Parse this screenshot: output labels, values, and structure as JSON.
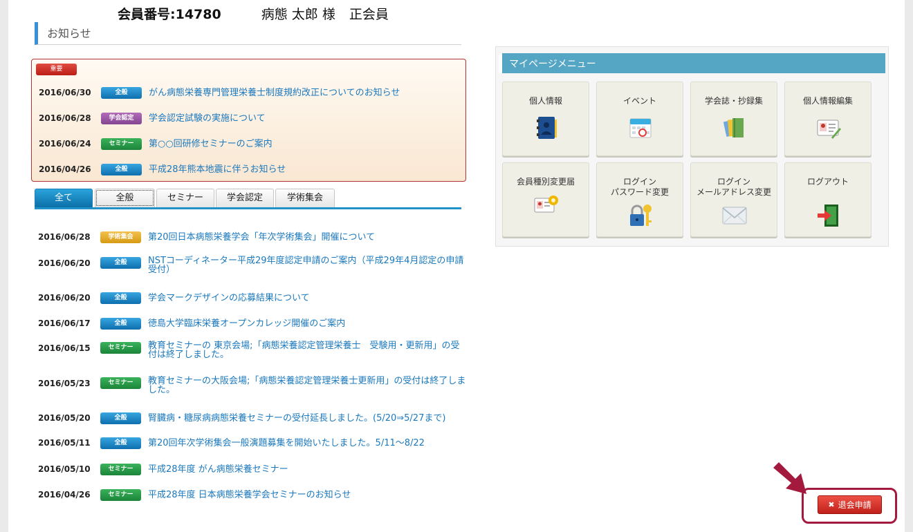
{
  "member": {
    "number": "会員番号:14780",
    "name": "病態 太郎 様",
    "type": "正会員"
  },
  "notices": {
    "heading": "お知らせ"
  },
  "important": {
    "label": "重要",
    "items": [
      {
        "date": "2016/06/30",
        "category": "全般",
        "title": "がん病態栄養専門管理栄養士制度規約改正についてのお知らせ"
      },
      {
        "date": "2016/06/28",
        "category": "学会認定",
        "title": "学会認定試験の実施について"
      },
      {
        "date": "2016/06/24",
        "category": "セミナー",
        "title": "第○○回研修セミナーのご案内"
      },
      {
        "date": "2016/04/26",
        "category": "全般",
        "title": "平成28年熊本地震に伴うお知らせ"
      }
    ]
  },
  "tabs": [
    "全て",
    "全般",
    "セミナー",
    "学会認定",
    "学術集会"
  ],
  "news": [
    {
      "date": "2016/06/28",
      "category": "学術集会",
      "title": "第20回日本病態栄養学会「年次学術集会」開催について"
    },
    {
      "date": "2016/06/20",
      "category": "全般",
      "title": "NSTコーディネーター平成29年度認定申請のご案内（平成29年4月認定の申請受付）"
    },
    {
      "date": "2016/06/20",
      "category": "全般",
      "title": "学会マークデザインの応募結果について"
    },
    {
      "date": "2016/06/17",
      "category": "全般",
      "title": "徳島大学臨床栄養オープンカレッジ開催のご案内"
    },
    {
      "date": "2016/06/15",
      "category": "セミナー",
      "title": "教育セミナーの 東京会場;「病態栄養認定管理栄養士　受験用・更新用」の受付は終了しました。"
    },
    {
      "date": "2016/05/23",
      "category": "セミナー",
      "title": "教育セミナーの大阪会場;「病態栄養認定管理栄養士更新用」の受付は終了しました。"
    },
    {
      "date": "2016/05/20",
      "category": "全般",
      "title": "腎臓病・糖尿病病態栄養セミナーの受付延長しました。(5/20⇒5/27まで)"
    },
    {
      "date": "2016/05/11",
      "category": "全般",
      "title": "第20回年次学術集会一般演題募集を開始いたしました。5/11～8/22"
    },
    {
      "date": "2016/05/10",
      "category": "セミナー",
      "title": "平成28年度 がん病態栄養セミナー"
    },
    {
      "date": "2016/04/26",
      "category": "セミナー",
      "title": "平成28年度 日本病態栄養学会セミナーのお知らせ"
    }
  ],
  "mypage": {
    "title": "マイページメニュー",
    "tiles": [
      {
        "label": "個人情報",
        "icon": "address-book-icon"
      },
      {
        "label": "イベント",
        "icon": "calendar-icon"
      },
      {
        "label": "学会誌・抄録集",
        "icon": "books-icon"
      },
      {
        "label": "個人情報編集",
        "icon": "id-card-edit-icon"
      },
      {
        "label": "会員種別変更届",
        "icon": "id-card-gear-icon"
      },
      {
        "label": "ログイン\nパスワード変更",
        "icon": "lock-key-icon"
      },
      {
        "label": "ログイン\nメールアドレス変更",
        "icon": "envelope-icon"
      },
      {
        "label": "ログアウト",
        "icon": "exit-door-icon"
      }
    ]
  },
  "withdraw": {
    "label": "退会申請",
    "icon": "x-icon"
  },
  "colors": {
    "accent": "#1e92c9",
    "link": "#1a78bd",
    "important_border": "#b13434",
    "menu_header": "#55a5c5",
    "withdraw": "#c0201a",
    "highlight_frame": "#a31a3e"
  }
}
